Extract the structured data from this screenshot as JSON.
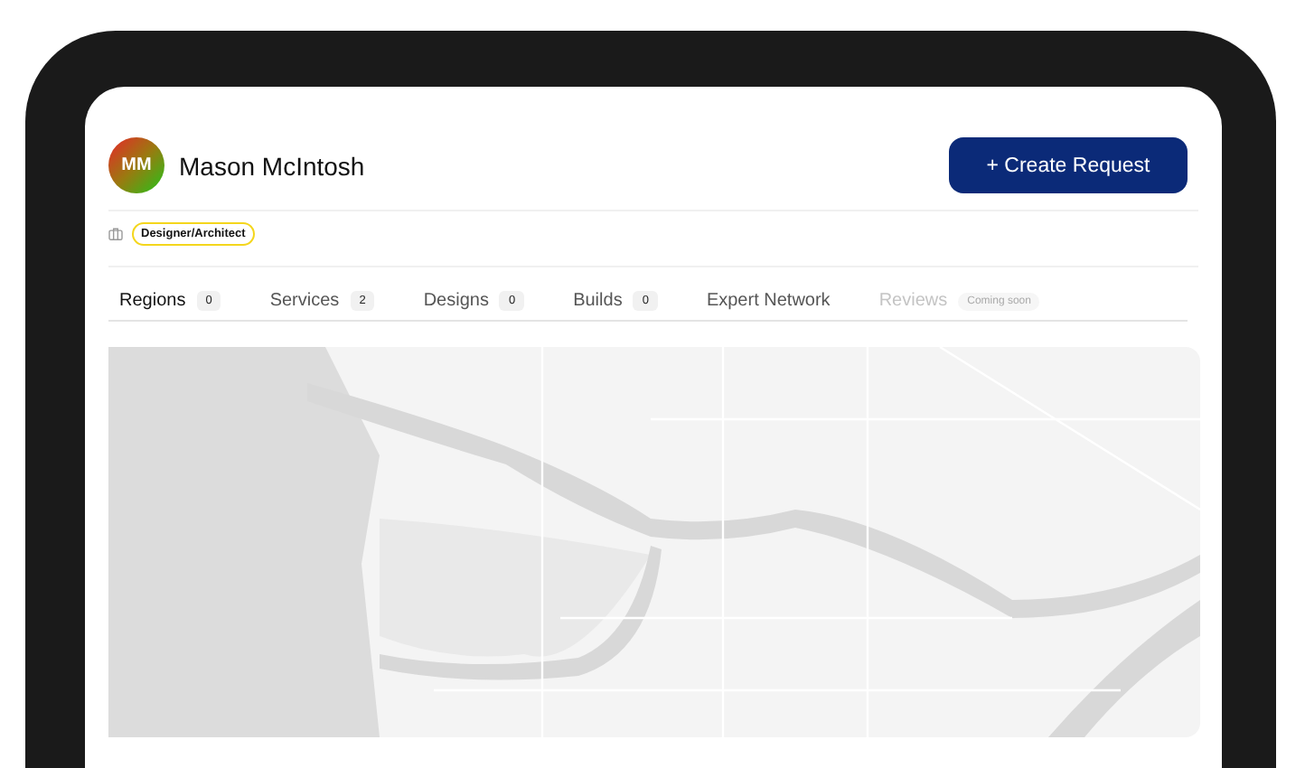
{
  "profile": {
    "initials": "MM",
    "name": "Mason McIntosh",
    "role": "Designer/Architect"
  },
  "create_button": {
    "label": "+ Create Request"
  },
  "tabs": [
    {
      "label": "Regions",
      "count": "0",
      "selected": true,
      "disabled": false
    },
    {
      "label": "Services",
      "count": "2",
      "selected": false,
      "disabled": false
    },
    {
      "label": "Designs",
      "count": "0",
      "selected": false,
      "disabled": false
    },
    {
      "label": "Builds",
      "count": "0",
      "selected": false,
      "disabled": false
    },
    {
      "label": "Expert Network",
      "selected": false,
      "disabled": false
    },
    {
      "label": "Reviews",
      "tag": "Coming soon",
      "selected": false,
      "disabled": true
    }
  ]
}
